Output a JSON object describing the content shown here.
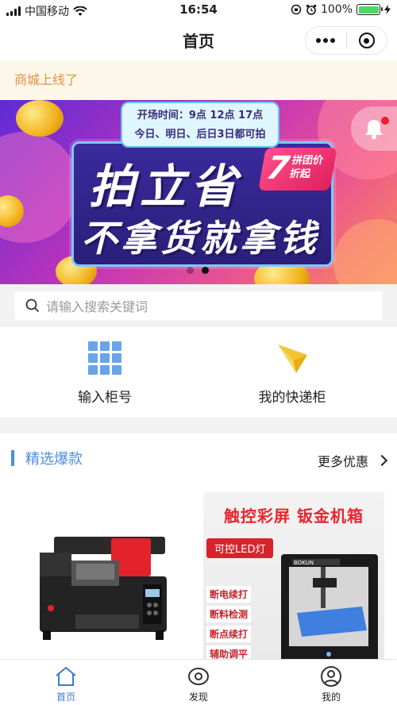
{
  "status_bar": {
    "carrier": "中国移动",
    "time": "16:54",
    "battery_percent": "100%",
    "battery_level": 1.0
  },
  "nav": {
    "title": "首页"
  },
  "notice": {
    "text": "商城上线了"
  },
  "banner": {
    "schedule_line1": "开场时间：9点  12点  17点",
    "schedule_line2": "今日、明日、后日3日都可拍",
    "headline": "拍立省",
    "subline": "不拿货就拿钱",
    "badge_number": "7",
    "badge_text_1": "拼团价",
    "badge_text_2": "折起",
    "slide_count": 2,
    "active_slide": 2
  },
  "search": {
    "placeholder": "请输入搜索关键词"
  },
  "quick_actions": [
    {
      "label": "输入柜号",
      "icon": "grid-icon"
    },
    {
      "label": "我的快递柜",
      "icon": "paper-plane-icon"
    }
  ],
  "featured": {
    "title": "精选爆款",
    "more": "更多优惠",
    "product2": {
      "title": "触控彩屏 钣金机箱",
      "tag": "可控LED灯",
      "brand": "BOKUN",
      "features": [
        "断电续打",
        "断料检测",
        "断点续打",
        "辅助调平"
      ]
    }
  },
  "tabbar": [
    {
      "label": "首页",
      "icon": "home-icon",
      "active": true
    },
    {
      "label": "发现",
      "icon": "eye-icon",
      "active": false
    },
    {
      "label": "我的",
      "icon": "user-icon",
      "active": false
    }
  ],
  "colors": {
    "accent": "#3a7bd5",
    "notice_text": "#e3913a",
    "notice_bg": "#fdf7ea",
    "section_title": "#4a8fde"
  }
}
